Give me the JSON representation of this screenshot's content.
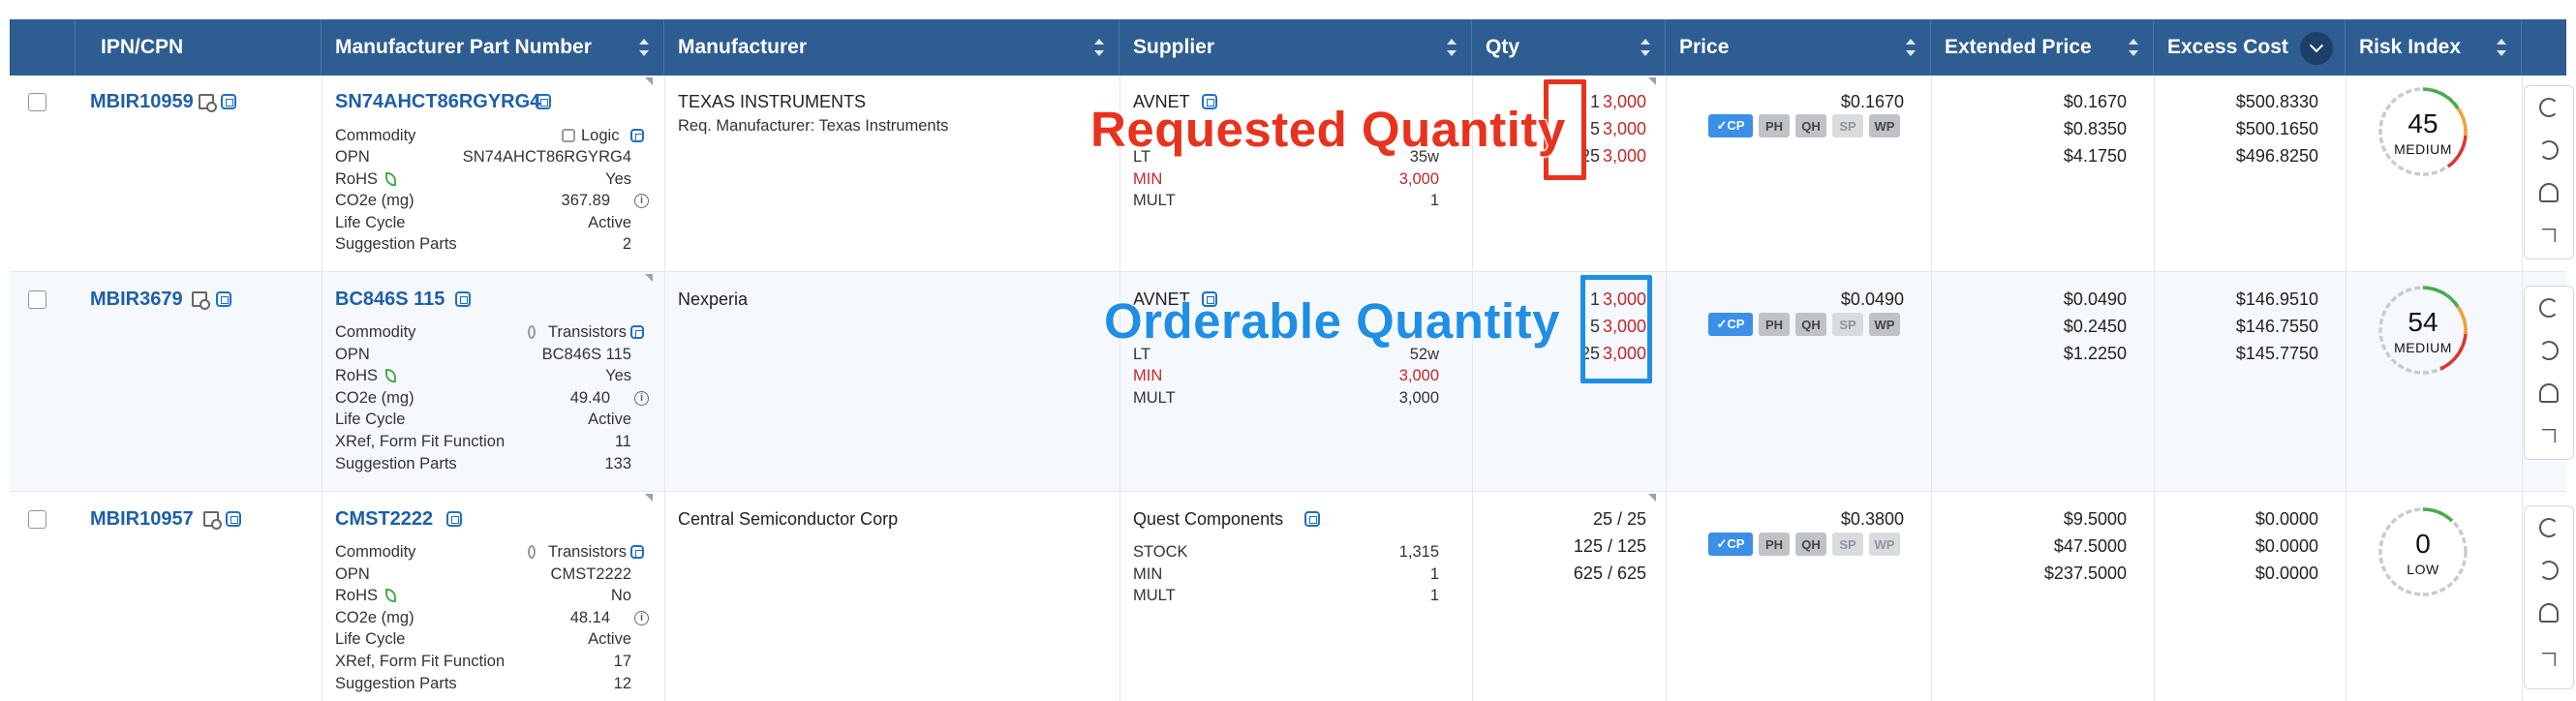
{
  "columns": [
    {
      "label": "IPN/CPN"
    },
    {
      "label": "Manufacturer Part Number"
    },
    {
      "label": "Manufacturer"
    },
    {
      "label": "Supplier"
    },
    {
      "label": "Qty"
    },
    {
      "label": "Price"
    },
    {
      "label": "Extended Price"
    },
    {
      "label": "Excess Cost"
    },
    {
      "label": "Risk Index"
    }
  ],
  "rows": [
    {
      "ipn": "MBIR10959",
      "mpn": "SN74AHCT86RGYRG4",
      "attrs": [
        {
          "k": "Commodity",
          "v": "Logic"
        },
        {
          "k": "OPN",
          "v": "SN74AHCT86RGYRG4"
        },
        {
          "k": "RoHS",
          "v": "Yes"
        },
        {
          "k": "CO2e (mg)",
          "v": "367.89"
        },
        {
          "k": "Life Cycle",
          "v": "Active"
        },
        {
          "k": "Suggestion Parts",
          "v": "2"
        }
      ],
      "manufacturer": "TEXAS INSTRUMENTS",
      "manufacturer_sub": "Req. Manufacturer: Texas Instruments",
      "supplier": "AVNET",
      "sup_attrs": [
        {
          "k": "LT",
          "v": "35w"
        },
        {
          "k": "MIN",
          "v": "3,000"
        },
        {
          "k": "MULT",
          "v": "1"
        }
      ],
      "qty": [
        {
          "req": "1",
          "ord": "3,000"
        },
        {
          "req": "5",
          "ord": "3,000"
        },
        {
          "req": "25",
          "ord": "3,000"
        }
      ],
      "price": "$0.1670",
      "ext": [
        "$0.1670",
        "$0.8350",
        "$4.1750"
      ],
      "excess": [
        "$500.8330",
        "$500.1650",
        "$496.8250"
      ],
      "risk": {
        "value": "45",
        "label": "MEDIUM"
      }
    },
    {
      "ipn": "MBIR3679",
      "mpn": "BC846S 115",
      "attrs": [
        {
          "k": "Commodity",
          "v": "Transistors"
        },
        {
          "k": "OPN",
          "v": "BC846S 115"
        },
        {
          "k": "RoHS",
          "v": "Yes"
        },
        {
          "k": "CO2e (mg)",
          "v": "49.40"
        },
        {
          "k": "Life Cycle",
          "v": "Active"
        },
        {
          "k": "XRef, Form Fit Function",
          "v": "11"
        },
        {
          "k": "Suggestion Parts",
          "v": "133"
        }
      ],
      "manufacturer": "Nexperia",
      "supplier": "AVNET",
      "sup_attrs": [
        {
          "k": "LT",
          "v": "52w"
        },
        {
          "k": "MIN",
          "v": "3,000"
        },
        {
          "k": "MULT",
          "v": "3,000"
        }
      ],
      "qty": [
        {
          "req": "1",
          "ord": "3,000"
        },
        {
          "req": "5",
          "ord": "3,000"
        },
        {
          "req": "25",
          "ord": "3,000"
        }
      ],
      "price": "$0.0490",
      "ext": [
        "$0.0490",
        "$0.2450",
        "$1.2250"
      ],
      "excess": [
        "$146.9510",
        "$146.7550",
        "$145.7750"
      ],
      "risk": {
        "value": "54",
        "label": "MEDIUM"
      }
    },
    {
      "ipn": "MBIR10957",
      "mpn": "CMST2222",
      "attrs": [
        {
          "k": "Commodity",
          "v": "Transistors"
        },
        {
          "k": "OPN",
          "v": "CMST2222"
        },
        {
          "k": "RoHS",
          "v": "No"
        },
        {
          "k": "CO2e (mg)",
          "v": "48.14"
        },
        {
          "k": "Life Cycle",
          "v": "Active"
        },
        {
          "k": "XRef, Form Fit Function",
          "v": "17"
        },
        {
          "k": "Suggestion Parts",
          "v": "12"
        }
      ],
      "manufacturer": "Central Semiconductor Corp",
      "supplier": "Quest Components",
      "sup_attrs": [
        {
          "k": "STOCK",
          "v": "1,315"
        },
        {
          "k": "MIN",
          "v": "1"
        },
        {
          "k": "MULT",
          "v": "1"
        }
      ],
      "qty_text": [
        "25 / 25",
        "125 / 125",
        "625 / 625"
      ],
      "price": "$0.3800",
      "ext": [
        "$9.5000",
        "$47.5000",
        "$237.5000"
      ],
      "excess": [
        "$0.0000",
        "$0.0000",
        "$0.0000"
      ],
      "risk": {
        "value": "0",
        "label": "LOW"
      }
    }
  ],
  "price_badges": [
    "✓CP",
    "PH",
    "QH",
    "SP",
    "WP"
  ],
  "annotations": {
    "requested": "Requested Quantity",
    "orderable": "Orderable Quantity"
  },
  "colors": {
    "header": "#2e5d91",
    "link": "#1f5fa8",
    "min_red": "#c0282b",
    "annot_red": "#e8321e",
    "annot_blue": "#1f8fe6",
    "badge_cp": "#3b8fe6"
  }
}
